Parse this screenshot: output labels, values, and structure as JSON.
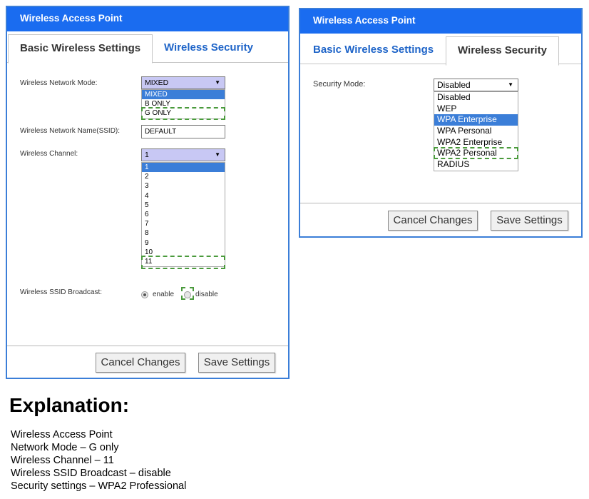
{
  "left_panel": {
    "title": "Wireless Access Point",
    "tabs": [
      "Basic Wireless Settings",
      "Wireless Security"
    ],
    "network_mode": {
      "label": "Wireless Network Mode:",
      "selected": "MIXED",
      "options": [
        "MIXED",
        "B ONLY",
        "G ONLY"
      ]
    },
    "ssid": {
      "label": "Wireless Network Name(SSID):",
      "value": "DEFAULT"
    },
    "channel": {
      "label": "Wireless Channel:",
      "selected": "1",
      "options": [
        "1",
        "2",
        "3",
        "4",
        "5",
        "6",
        "7",
        "8",
        "9",
        "10",
        "11"
      ]
    },
    "ssid_broadcast": {
      "label": "Wireless SSID Broadcast:",
      "enable": "enable",
      "disable": "disable"
    },
    "cancel": "Cancel Changes",
    "save": "Save Settings"
  },
  "right_panel": {
    "title": "Wireless Access Point",
    "tabs": [
      "Basic Wireless Settings",
      "Wireless Security"
    ],
    "security_mode": {
      "label": "Security Mode:",
      "selected": "Disabled",
      "options": [
        "Disabled",
        "WEP",
        "WPA Enterprise",
        "WPA Personal",
        "WPA2 Enterprise",
        "WPA2 Personal",
        "RADIUS"
      ]
    },
    "cancel": "Cancel Changes",
    "save": "Save Settings"
  },
  "explanation": {
    "heading": "Explanation:",
    "lines": [
      "Wireless Access Point",
      "Network Mode – G only",
      "Wireless Channel – 11",
      "Wireless SSID Broadcast – disable",
      "Security settings – WPA2 Professional"
    ]
  },
  "colors": {
    "titlebar": "#1a6cf0",
    "border": "#3b7ed8",
    "highlight": "#3b7ed8",
    "dash": "#4a9a3c"
  }
}
